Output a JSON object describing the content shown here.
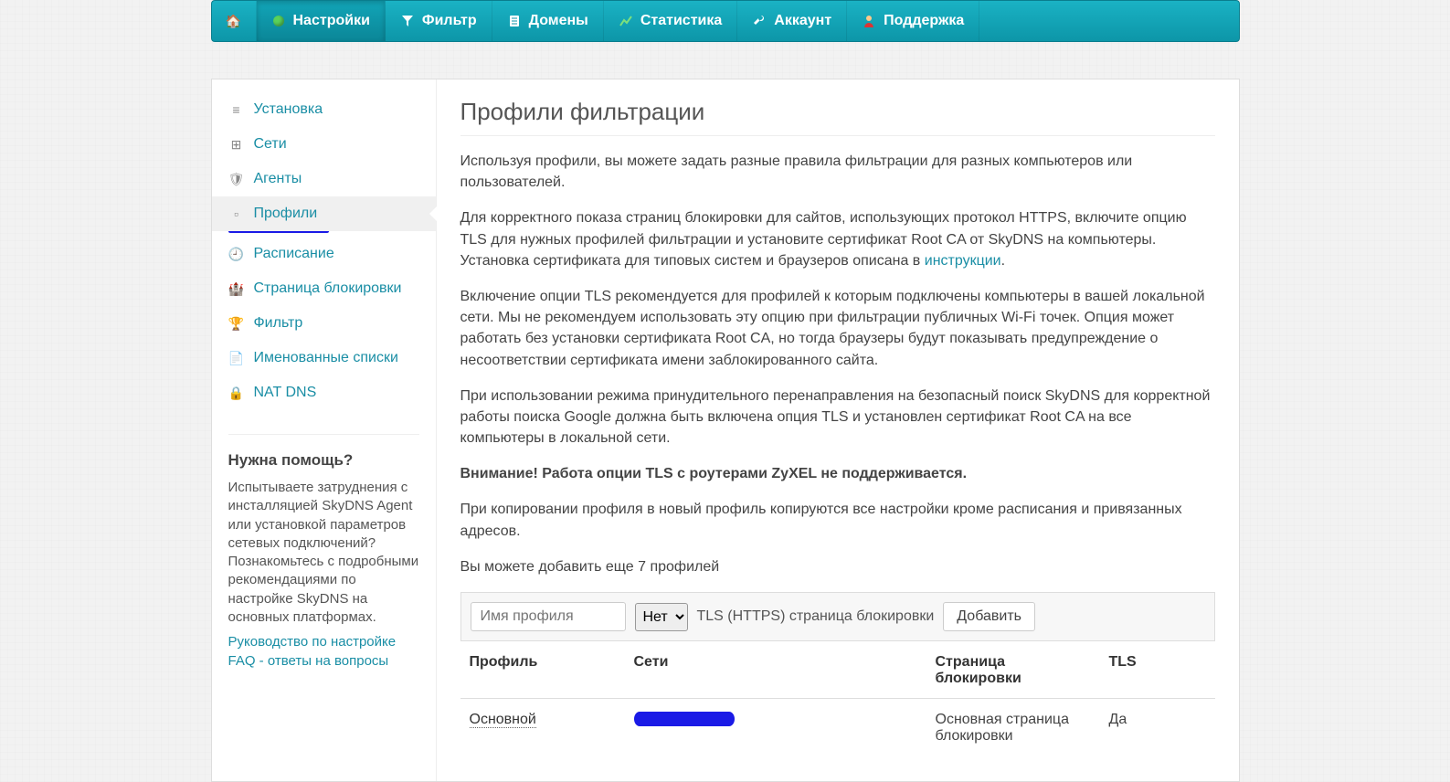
{
  "topnav": {
    "items": [
      {
        "label": "",
        "icon": "home"
      },
      {
        "label": "Настройки",
        "icon": "dot-green",
        "active": true
      },
      {
        "label": "Фильтр",
        "icon": "funnel"
      },
      {
        "label": "Домены",
        "icon": "doc"
      },
      {
        "label": "Статистика",
        "icon": "chart"
      },
      {
        "label": "Аккаунт",
        "icon": "wrench"
      },
      {
        "label": "Поддержка",
        "icon": "user"
      }
    ]
  },
  "sidebar": {
    "items": [
      {
        "label": "Установка",
        "icon": "≡"
      },
      {
        "label": "Сети",
        "icon": "⊞"
      },
      {
        "label": "Агенты",
        "icon": "🛡"
      },
      {
        "label": "Профили",
        "icon": "▫",
        "active": true
      },
      {
        "label": "Расписание",
        "icon": "🕘"
      },
      {
        "label": "Страница блокировки",
        "icon": "🏰"
      },
      {
        "label": "Фильтр",
        "icon": "🏆"
      },
      {
        "label": "Именованные списки",
        "icon": "📄"
      },
      {
        "label": "NAT DNS",
        "icon": "🔒"
      }
    ]
  },
  "help": {
    "title": "Нужна помощь?",
    "text": "Испытываете затруднения с инсталляцией SkyDNS Agent или установкой параметров сетевых подключений? Познакомьтесь с подробными рекомендациями по настройке SkyDNS на основных платформах.",
    "links": [
      "Руководство по настройке",
      "FAQ - ответы на вопросы"
    ]
  },
  "main": {
    "title": "Профили фильтрации",
    "p1": "Используя профили, вы можете задать разные правила фильтрации для разных компьютеров или пользователей.",
    "p2a": "Для корректного показа страниц блокировки для сайтов, использующих протокол HTTPS, включите опцию TLS для нужных профилей фильтрации и установите сертификат Root CA от SkyDNS на компьютеры. Установка сертификата для типовых систем и браузеров описана в ",
    "p2link": "инструкции",
    "p2b": ".",
    "p3": "Включение опции TLS рекомендуется для профилей к которым подключены компьютеры в вашей локальной сети. Мы не рекомендуем использовать эту опцию при фильтрации публичных Wi-Fi точек. Опция может работать без установки сертификата Root CA, но тогда браузеры будут показывать предупреждение о несоответствии сертификата имени заблокированного сайта.",
    "p4": "При использовании режима принудительного перенаправления на безопасный поиск SkyDNS для корректной работы поиска Google должна быть включена опция TLS и установлен сертификат Root CA на все компьютеры в локальной сети.",
    "warning": "Внимание! Работа опции TLS с роутерами ZyXEL не поддерживается.",
    "p5": "При копировании профиля в новый профиль копируются все настройки кроме расписания и привязанных адресов.",
    "remaining": "Вы можете добавить еще 7 профилей",
    "form": {
      "placeholder": "Имя профиля",
      "tls_select": "Нет",
      "tls_label": "TLS (HTTPS) страница блокировки",
      "add_button": "Добавить"
    },
    "table": {
      "headers": {
        "profile": "Профиль",
        "networks": "Сети",
        "blockpage": "Страница блокировки",
        "tls": "TLS"
      },
      "rows": [
        {
          "profile": "Основной",
          "networks_redacted": true,
          "blockpage": "Основная страница блокировки",
          "tls": "Да"
        }
      ]
    }
  }
}
